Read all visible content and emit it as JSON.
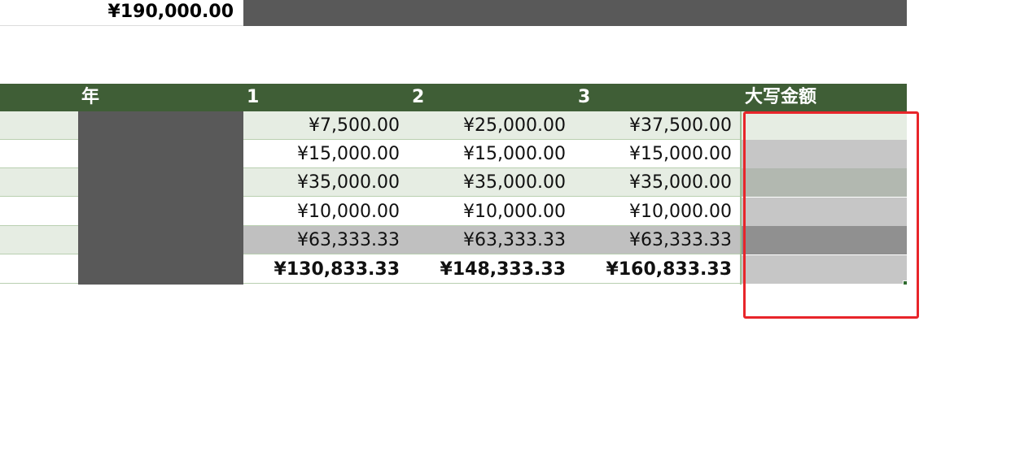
{
  "top_row": {
    "total_value": "¥190,000.00"
  },
  "header": {
    "year_label": "年",
    "col1": "1",
    "col2": "2",
    "col3": "3",
    "amount_in_words": "大写金额"
  },
  "rows": [
    {
      "v1": "¥7,500.00",
      "v2": "¥25,000.00",
      "v3": "¥37,500.00"
    },
    {
      "v1": "¥15,000.00",
      "v2": "¥15,000.00",
      "v3": "¥15,000.00"
    },
    {
      "v1": "¥35,000.00",
      "v2": "¥35,000.00",
      "v3": "¥35,000.00"
    },
    {
      "v1": "¥10,000.00",
      "v2": "¥10,000.00",
      "v3": "¥10,000.00"
    },
    {
      "v1": "¥63,333.33",
      "v2": "¥63,333.33",
      "v3": "¥63,333.33"
    },
    {
      "v1": "¥130,833.33",
      "v2": "¥148,333.33",
      "v3": "¥160,833.33"
    }
  ],
  "colors": {
    "header_green": "#3f5e36",
    "dark_fill": "#595959",
    "selection_outline": "#e8252a"
  }
}
